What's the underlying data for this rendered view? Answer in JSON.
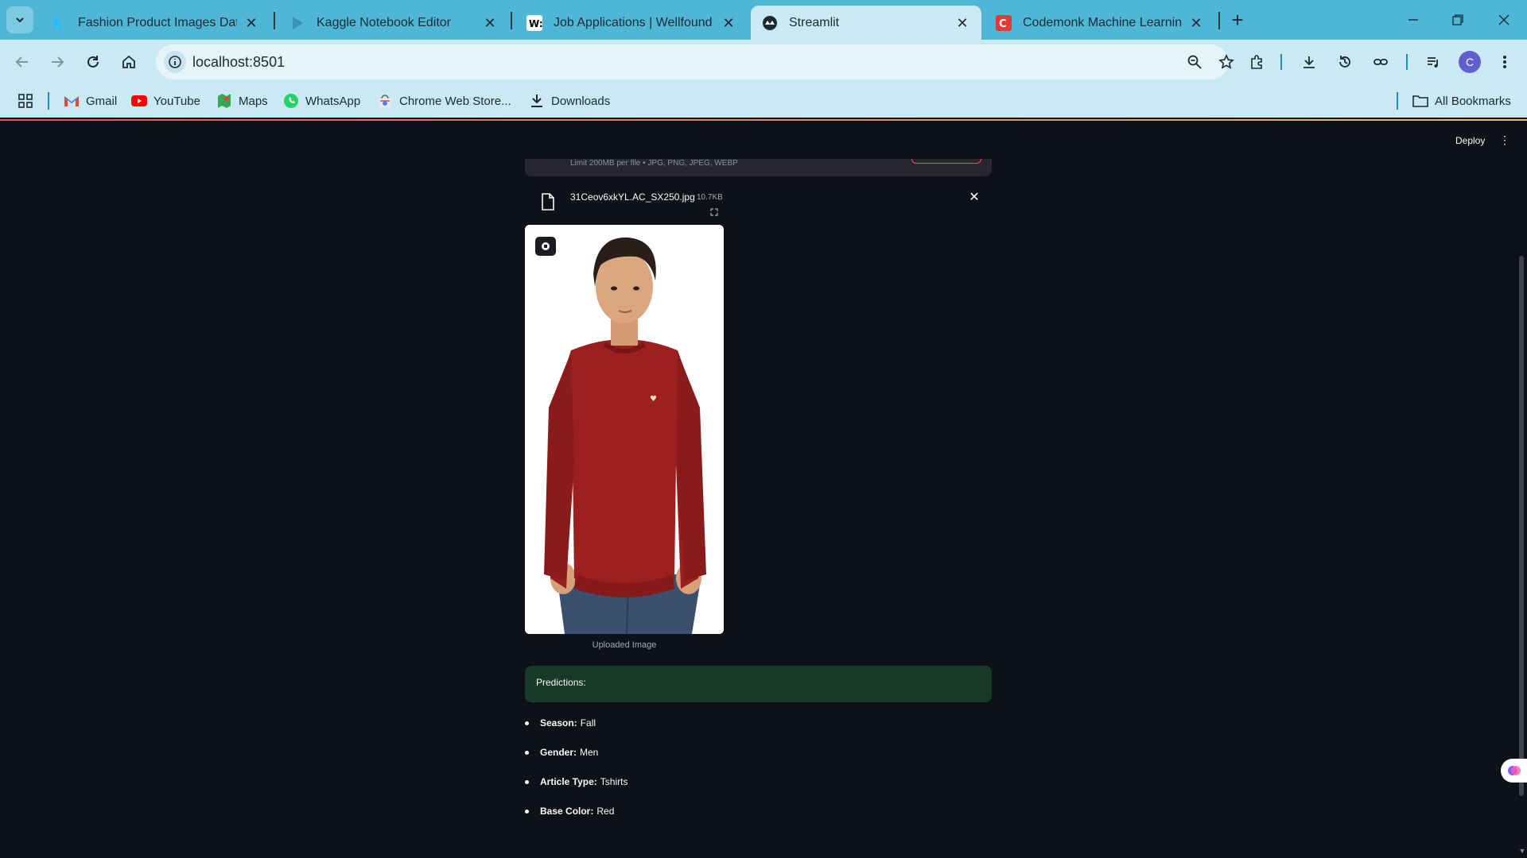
{
  "browser": {
    "tabs": [
      {
        "title": "Fashion Product Images Dataset",
        "icon": "kaggle-icon"
      },
      {
        "title": "Kaggle Notebook Editor",
        "icon": "kaggle-play-icon"
      },
      {
        "title": "Job Applications | Wellfound",
        "icon": "wellfound-icon"
      },
      {
        "title": "Streamlit",
        "icon": "streamlit-icon",
        "active": true
      },
      {
        "title": "Codemonk Machine Learning In",
        "icon": "codemonk-icon"
      }
    ],
    "address_bar": {
      "url": "localhost:8501"
    },
    "profile_initial": "C",
    "bookmarks": [
      {
        "label": "Gmail",
        "icon": "gmail-icon"
      },
      {
        "label": "YouTube",
        "icon": "youtube-icon"
      },
      {
        "label": "Maps",
        "icon": "maps-icon"
      },
      {
        "label": "WhatsApp",
        "icon": "whatsapp-icon"
      },
      {
        "label": "Chrome Web Store...",
        "icon": "chrome-web-store-icon"
      },
      {
        "label": "Downloads",
        "icon": "download-icon"
      }
    ],
    "all_bookmarks_label": "All Bookmarks",
    "colors": {
      "chrome": "#4fb6d6",
      "toolbar": "#c9e9f3",
      "accent": "#1f8fb8"
    }
  },
  "app": {
    "deploy_label": "Deploy",
    "uploader": {
      "hint": "Limit 200MB per file • JPG, PNG, JPEG, WEBP",
      "file_name": "31Ceov6xkYL.AC_SX250.jpg",
      "file_size": "10.7KB"
    },
    "image_caption": "Uploaded Image",
    "predictions_title": "Predictions:",
    "predictions": [
      {
        "key": "Season:",
        "value": "Fall"
      },
      {
        "key": "Gender:",
        "value": "Men"
      },
      {
        "key": "Article Type:",
        "value": "Tshirts"
      },
      {
        "key": "Base Color:",
        "value": "Red"
      }
    ],
    "colors": {
      "background": "#0e1117",
      "success_box": "#173928",
      "primary": "#ff4b4b",
      "text": "#fafafa"
    }
  }
}
